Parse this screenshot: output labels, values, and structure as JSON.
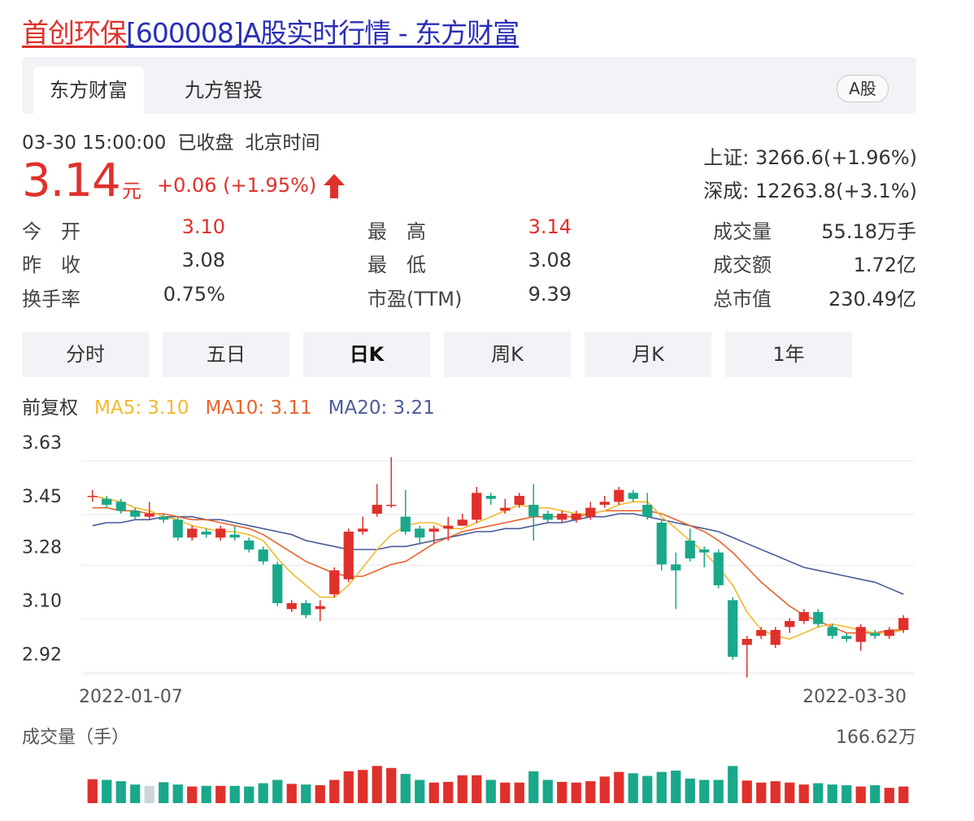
{
  "header": {
    "title_prefix": "首创环保",
    "title_rest": "[600008]A股实时行情 - 东方财富"
  },
  "tabs": [
    {
      "label": "东方财富",
      "active": true
    },
    {
      "label": "九方智投",
      "active": false
    }
  ],
  "badge": "A股",
  "quote": {
    "datetime": "03-30 15:00:00",
    "status": "已收盘",
    "timezone": "北京时间",
    "price": "3.14",
    "unit": "元",
    "change": "+0.06 (+1.95%)",
    "up_color": "#e0302b",
    "down_color": "#1aa88a"
  },
  "indices": [
    {
      "name": "上证",
      "value": "3266.6(+1.96%)"
    },
    {
      "name": "深成",
      "value": "12263.8(+3.1%)"
    }
  ],
  "stats": [
    [
      {
        "label": "今　开",
        "value": "3.10",
        "color": "red"
      },
      {
        "label": "最　高",
        "value": "3.14",
        "color": "red"
      },
      {
        "label": "成交量",
        "value": "55.18万手",
        "color": "dark"
      }
    ],
    [
      {
        "label": "昨　收",
        "value": "3.08",
        "color": "dark"
      },
      {
        "label": "最　低",
        "value": "3.08",
        "color": "dark"
      },
      {
        "label": "成交额",
        "value": "1.72亿",
        "color": "dark"
      }
    ],
    [
      {
        "label": "换手率",
        "value": "0.75%",
        "color": "dark"
      },
      {
        "label": "市盈(TTM)",
        "value": "9.39",
        "color": "dark"
      },
      {
        "label": "总市值",
        "value": "230.49亿",
        "color": "dark"
      }
    ]
  ],
  "periods": [
    {
      "label": "分时",
      "active": false
    },
    {
      "label": "五日",
      "active": false
    },
    {
      "label": "日K",
      "active": true
    },
    {
      "label": "周K",
      "active": false
    },
    {
      "label": "月K",
      "active": false
    },
    {
      "label": "1年",
      "active": false
    }
  ],
  "ma": {
    "adjust": "前复权",
    "ma5": "MA5: 3.10",
    "ma10": "MA10: 3.11",
    "ma20": "MA20: 3.21",
    "ma5_color": "#f5b82e",
    "ma10_color": "#e8642c",
    "ma20_color": "#4a5a9a"
  },
  "chart_data": {
    "type": "candlestick",
    "y_ticks": [
      "3.63",
      "3.45",
      "3.28",
      "3.10",
      "2.92"
    ],
    "ylim": [
      2.85,
      3.63
    ],
    "x_start_label": "2022-01-07",
    "x_end_label": "2022-03-30",
    "candles": [
      [
        3.45,
        3.45,
        3.47,
        3.43
      ],
      [
        3.44,
        3.42,
        3.45,
        3.41
      ],
      [
        3.43,
        3.4,
        3.44,
        3.39
      ],
      [
        3.4,
        3.38,
        3.41,
        3.37
      ],
      [
        3.38,
        3.39,
        3.43,
        3.37
      ],
      [
        3.38,
        3.37,
        3.39,
        3.36
      ],
      [
        3.37,
        3.31,
        3.38,
        3.3
      ],
      [
        3.31,
        3.34,
        3.35,
        3.3
      ],
      [
        3.33,
        3.32,
        3.34,
        3.31
      ],
      [
        3.31,
        3.34,
        3.35,
        3.3
      ],
      [
        3.32,
        3.31,
        3.35,
        3.3
      ],
      [
        3.3,
        3.27,
        3.31,
        3.26
      ],
      [
        3.27,
        3.23,
        3.28,
        3.22
      ],
      [
        3.22,
        3.09,
        3.23,
        3.08
      ],
      [
        3.07,
        3.09,
        3.1,
        3.06
      ],
      [
        3.09,
        3.05,
        3.1,
        3.04
      ],
      [
        3.07,
        3.08,
        3.1,
        3.03
      ],
      [
        3.12,
        3.2,
        3.21,
        3.11
      ],
      [
        3.17,
        3.33,
        3.34,
        3.16
      ],
      [
        3.33,
        3.34,
        3.38,
        3.32
      ],
      [
        3.39,
        3.42,
        3.49,
        3.38
      ],
      [
        3.42,
        3.42,
        3.58,
        3.41
      ],
      [
        3.38,
        3.33,
        3.47,
        3.32
      ],
      [
        3.34,
        3.31,
        3.35,
        3.29
      ],
      [
        3.33,
        3.34,
        3.35,
        3.29
      ],
      [
        3.34,
        3.35,
        3.38,
        3.3
      ],
      [
        3.35,
        3.37,
        3.39,
        3.35
      ],
      [
        3.37,
        3.46,
        3.48,
        3.36
      ],
      [
        3.45,
        3.44,
        3.46,
        3.42
      ],
      [
        3.4,
        3.41,
        3.44,
        3.39
      ],
      [
        3.42,
        3.45,
        3.46,
        3.41
      ],
      [
        3.42,
        3.38,
        3.49,
        3.3
      ],
      [
        3.39,
        3.37,
        3.4,
        3.36
      ],
      [
        3.37,
        3.39,
        3.4,
        3.36
      ],
      [
        3.37,
        3.39,
        3.4,
        3.36
      ],
      [
        3.38,
        3.41,
        3.43,
        3.37
      ],
      [
        3.42,
        3.43,
        3.45,
        3.41
      ],
      [
        3.43,
        3.47,
        3.48,
        3.42
      ],
      [
        3.46,
        3.44,
        3.47,
        3.43
      ],
      [
        3.42,
        3.38,
        3.46,
        3.37
      ],
      [
        3.36,
        3.22,
        3.37,
        3.2
      ],
      [
        3.22,
        3.2,
        3.26,
        3.07
      ],
      [
        3.3,
        3.24,
        3.34,
        3.23
      ],
      [
        3.27,
        3.26,
        3.28,
        3.21
      ],
      [
        3.26,
        3.15,
        3.27,
        3.14
      ],
      [
        3.1,
        2.91,
        3.11,
        2.9
      ],
      [
        2.95,
        2.97,
        2.98,
        2.84
      ],
      [
        2.98,
        3.0,
        3.01,
        2.97
      ],
      [
        2.95,
        3.0,
        3.01,
        2.94
      ],
      [
        3.01,
        3.03,
        3.04,
        2.99
      ],
      [
        3.03,
        3.06,
        3.07,
        3.02
      ],
      [
        3.06,
        3.02,
        3.07,
        3.01
      ],
      [
        3.01,
        2.98,
        3.02,
        2.97
      ],
      [
        2.98,
        2.97,
        2.99,
        2.96
      ],
      [
        2.96,
        3.01,
        3.02,
        2.93
      ],
      [
        2.99,
        2.98,
        3.0,
        2.97
      ],
      [
        2.98,
        3.0,
        3.01,
        2.97
      ],
      [
        3.0,
        3.04,
        3.05,
        2.99
      ]
    ],
    "ma5": [
      3.45,
      3.44,
      3.43,
      3.41,
      3.4,
      3.38,
      3.37,
      3.35,
      3.34,
      3.33,
      3.33,
      3.32,
      3.3,
      3.24,
      3.19,
      3.15,
      3.11,
      3.11,
      3.15,
      3.21,
      3.27,
      3.32,
      3.35,
      3.36,
      3.36,
      3.34,
      3.34,
      3.36,
      3.38,
      3.4,
      3.42,
      3.41,
      3.41,
      3.4,
      3.39,
      3.39,
      3.4,
      3.42,
      3.43,
      3.43,
      3.38,
      3.34,
      3.3,
      3.26,
      3.21,
      3.15,
      3.06,
      3.0,
      2.98,
      2.97,
      2.99,
      3.01,
      3.02,
      3.01,
      3.0,
      2.99,
      2.99,
      3.0
    ],
    "ma10": [
      3.41,
      3.41,
      3.4,
      3.4,
      3.39,
      3.39,
      3.38,
      3.37,
      3.37,
      3.36,
      3.35,
      3.34,
      3.32,
      3.29,
      3.26,
      3.23,
      3.21,
      3.19,
      3.18,
      3.18,
      3.2,
      3.22,
      3.23,
      3.26,
      3.29,
      3.31,
      3.33,
      3.34,
      3.35,
      3.36,
      3.37,
      3.38,
      3.38,
      3.38,
      3.38,
      3.39,
      3.4,
      3.4,
      3.4,
      3.4,
      3.39,
      3.37,
      3.35,
      3.33,
      3.3,
      3.26,
      3.21,
      3.16,
      3.12,
      3.08,
      3.05,
      3.03,
      3.01,
      2.99,
      2.99,
      2.99,
      3.0,
      3.0
    ],
    "ma20": [
      3.35,
      3.36,
      3.36,
      3.37,
      3.37,
      3.38,
      3.38,
      3.38,
      3.37,
      3.37,
      3.36,
      3.35,
      3.34,
      3.33,
      3.32,
      3.3,
      3.29,
      3.28,
      3.27,
      3.27,
      3.27,
      3.28,
      3.28,
      3.29,
      3.3,
      3.31,
      3.32,
      3.33,
      3.33,
      3.34,
      3.34,
      3.35,
      3.36,
      3.36,
      3.37,
      3.38,
      3.38,
      3.39,
      3.39,
      3.38,
      3.37,
      3.36,
      3.35,
      3.34,
      3.33,
      3.31,
      3.29,
      3.27,
      3.25,
      3.23,
      3.21,
      3.2,
      3.19,
      3.18,
      3.17,
      3.16,
      3.14,
      3.12
    ],
    "volume_label": "成交量（手）",
    "volume_max_label": "166.62万",
    "volume_max": 166.62,
    "volumes": [
      72,
      70,
      66,
      56,
      52,
      63,
      56,
      50,
      52,
      52,
      52,
      50,
      60,
      70,
      58,
      56,
      54,
      70,
      96,
      100,
      112,
      106,
      88,
      70,
      62,
      64,
      84,
      84,
      70,
      62,
      62,
      96,
      70,
      64,
      62,
      66,
      80,
      94,
      90,
      82,
      94,
      98,
      74,
      70,
      70,
      112,
      68,
      62,
      66,
      62,
      56,
      60,
      56,
      54,
      50,
      54,
      46,
      50
    ]
  }
}
